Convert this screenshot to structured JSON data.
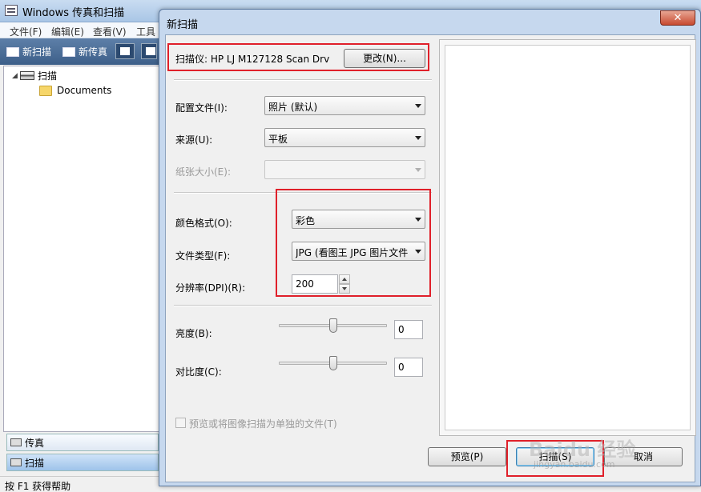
{
  "main_window": {
    "title": "Windows 传真和扫描",
    "menu": [
      "文件(F)",
      "编辑(E)",
      "查看(V)",
      "工具"
    ],
    "toolbar": {
      "new_scan": "新扫描",
      "new_fax": "新传真"
    },
    "tree": {
      "root": "扫描",
      "child": "Documents"
    },
    "nav": {
      "fax": "传真",
      "scan": "扫描"
    },
    "status": "按 F1 获得帮助"
  },
  "dialog": {
    "title": "新扫描",
    "close_glyph": "✕",
    "scanner_label": "扫描仪: HP LJ M127128 Scan Drv",
    "change_button": "更改(N)...",
    "profile": {
      "label": "配置文件(I):",
      "value": "照片 (默认)"
    },
    "source": {
      "label": "来源(U):",
      "value": "平板"
    },
    "paper_size": {
      "label": "纸张大小(E):",
      "value": ""
    },
    "color_format": {
      "label": "颜色格式(O):",
      "value": "彩色"
    },
    "file_type": {
      "label": "文件类型(F):",
      "value": "JPG (看图王 JPG 图片文件"
    },
    "resolution": {
      "label": "分辨率(DPI)(R):",
      "value": "200"
    },
    "brightness": {
      "label": "亮度(B):",
      "value": "0",
      "level": 0.5
    },
    "contrast": {
      "label": "对比度(C):",
      "value": "0",
      "level": 0.5
    },
    "separate_files": {
      "label": "预览或将图像扫描为单独的文件(T)",
      "checked": false
    },
    "preview_button": "预览(P)",
    "scan_button": "扫描(S)",
    "cancel_button": "取消"
  },
  "watermark": {
    "main": "Baidu 经验",
    "sub": "jingyan.baidu.com"
  },
  "colors": {
    "highlight": "#e0202a",
    "toolbar": "#4a6c96",
    "titlebar": "#c6d8ee"
  }
}
